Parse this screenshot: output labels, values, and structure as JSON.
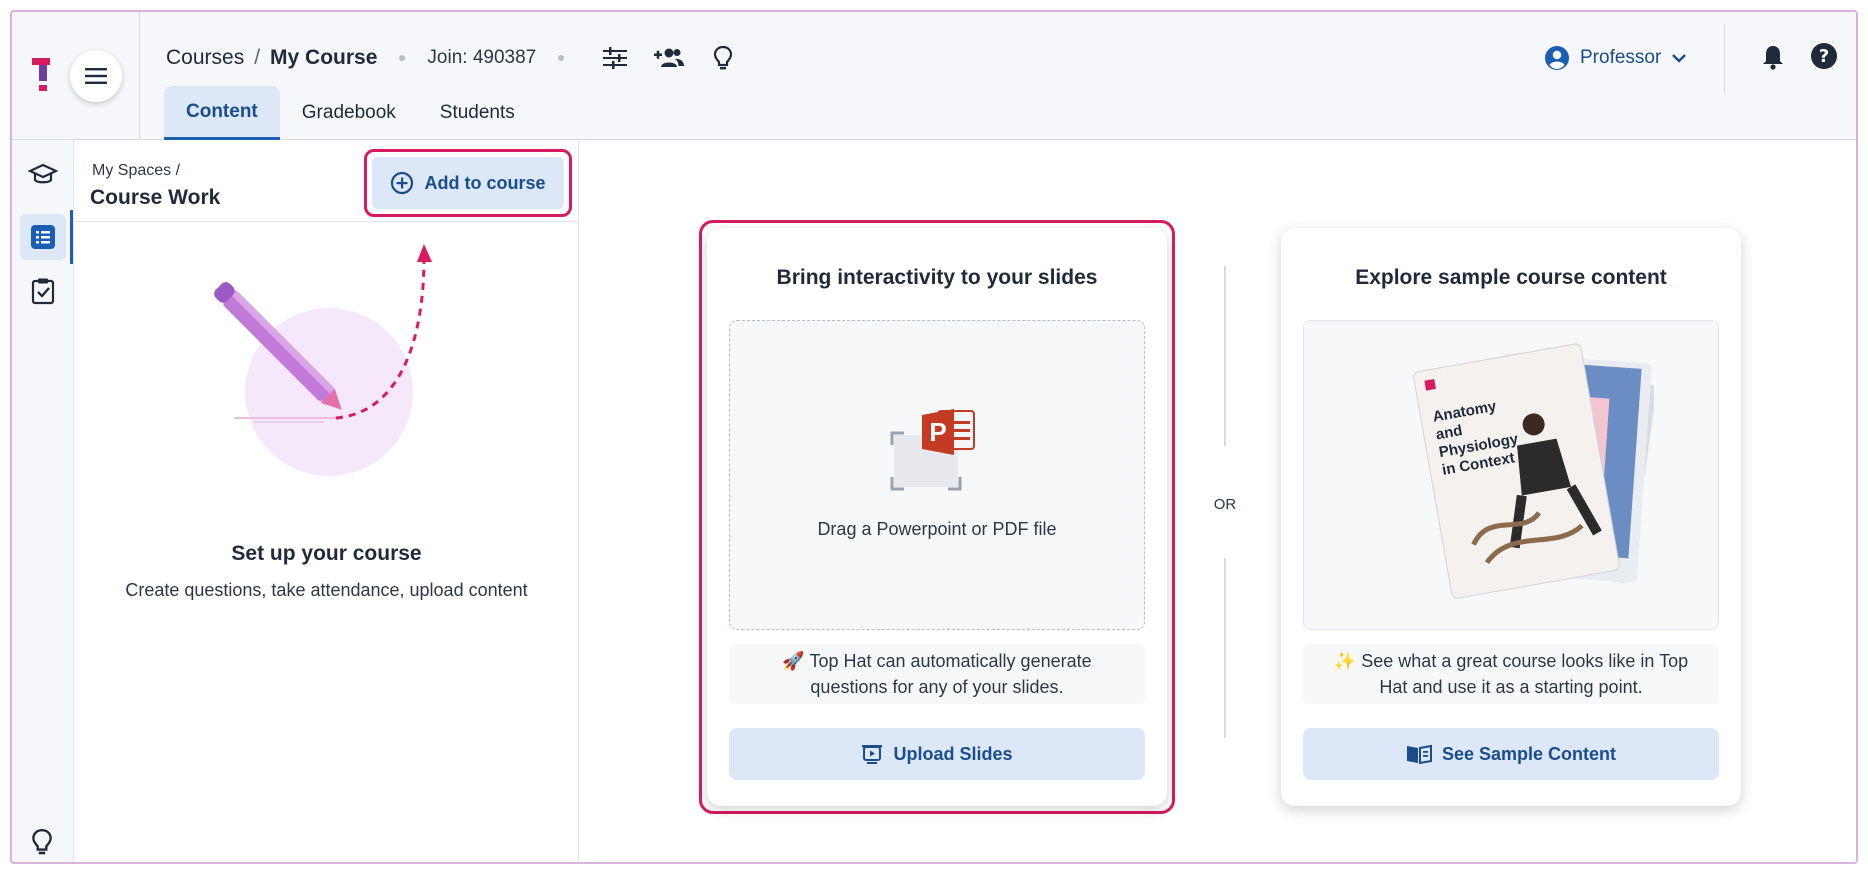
{
  "header": {
    "breadcrumb_root": "Courses",
    "breadcrumb_sep": "/",
    "breadcrumb_current": "My Course",
    "join_code": "Join: 490387",
    "tabs": [
      {
        "label": "Content"
      },
      {
        "label": "Gradebook"
      },
      {
        "label": "Students"
      }
    ],
    "profile_label": "Professor"
  },
  "panel": {
    "crumb": "My Spaces /",
    "title": "Course Work",
    "add_button": "Add to course",
    "setup_title": "Set up your course",
    "setup_subtitle": "Create questions, take attendance, upload content"
  },
  "main": {
    "slides_card": {
      "title": "Bring interactivity to your slides",
      "drop_text": "Drag a Powerpoint or PDF file",
      "note_line1": "🚀 Top Hat can automatically generate",
      "note_line2": "questions for any of your slides.",
      "button": "Upload Slides"
    },
    "or_label": "OR",
    "sample_card": {
      "title": "Explore sample course content",
      "book_title_1": "Anatomy",
      "book_title_2": "and",
      "book_title_3": "Physiology",
      "book_title_4": "in Context",
      "note_line1": "✨ See what a great course looks like in Top",
      "note_line2": "Hat and use it as a starting point.",
      "button": "See Sample Content"
    }
  },
  "colors": {
    "accent": "#1a5fb4",
    "highlight": "#d81b60",
    "button_bg": "#dce8f7"
  }
}
